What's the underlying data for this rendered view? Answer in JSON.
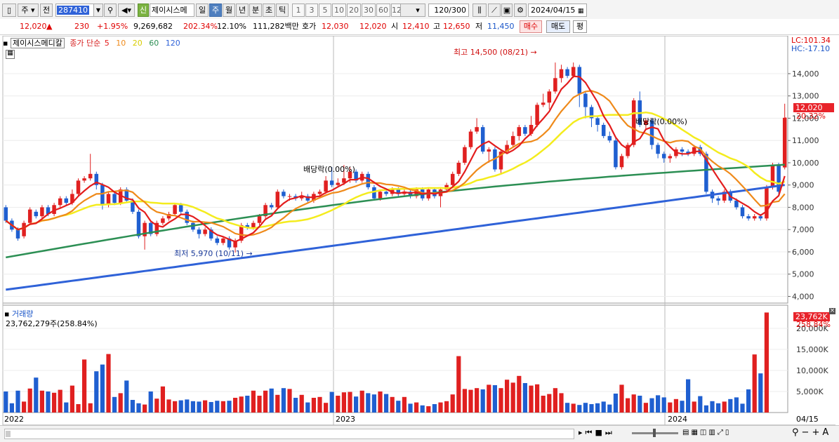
{
  "toolbar": {
    "chart_type": "주",
    "prev_label": "전",
    "code": "287410",
    "stock_tag": "신",
    "stock_name": "제이시스메",
    "periods": [
      "일",
      "주",
      "월",
      "년",
      "분",
      "초",
      "틱"
    ],
    "active_period": "주",
    "minutes": [
      "1",
      "3",
      "5",
      "10",
      "20",
      "30",
      "60",
      "120"
    ],
    "count": "120",
    "count_max": "/300",
    "date": "2024/04/15"
  },
  "quote": {
    "price": "12,020",
    "change": "230",
    "change_pct": "+1.95%",
    "volume": "9,269,682",
    "volume_ratio": "202.34%",
    "turnover": "12.10%",
    "amount": "111,282백만",
    "bid_label": "호가",
    "bid1": "12,030",
    "bid2": "12,020",
    "open_label": "시",
    "open": "12,410",
    "high_label": "고",
    "high": "12,650",
    "low_label": "저",
    "low": "11,450",
    "buy": "매수",
    "sell": "매도",
    "eval": "평"
  },
  "legend": {
    "name": "제이시스메디칼",
    "ma_title": "종가 단순",
    "ma": [
      {
        "period": "5",
        "color": "#e31d1d"
      },
      {
        "period": "10",
        "color": "#ef8a1a"
      },
      {
        "period": "20",
        "color": "#f4ec1e"
      },
      {
        "period": "60",
        "color": "#2c8f54"
      },
      {
        "period": "120",
        "color": "#2f62d8"
      }
    ]
  },
  "side": {
    "lc": "LC:101.34",
    "hc": "HC:-17.10",
    "price_badge": "12,020",
    "price_pct": "20.32%",
    "vol_badge": "23,762K",
    "vol_pct": "258.84%"
  },
  "annotations": {
    "high": "최고 14,500 (08/21)",
    "low": "최저 5,970 (10/11)",
    "dividend1": "배당락(0.00%)",
    "dividend2": "배당락(0.00%)"
  },
  "volume_pane": {
    "title": "거래량",
    "value": "23,762,279주(258.84%)"
  },
  "x_labels": [
    "2022",
    "2023",
    "2024"
  ],
  "last_date": "04/15",
  "chart_data": {
    "type": "candlestick",
    "title": "제이시스메디칼",
    "y_ticks": [
      4000,
      5000,
      6000,
      7000,
      8000,
      9000,
      10000,
      11000,
      12000,
      13000,
      14000
    ],
    "ylim": [
      3700,
      15700
    ],
    "vol_ticks": [
      "5,000K",
      "10,000K",
      "15,000K",
      "20,000K"
    ],
    "vol_tick_values": [
      5000,
      10000,
      15000,
      20000
    ],
    "vol_lim": [
      0,
      24500
    ],
    "candles": [
      [
        8000,
        7400,
        8100,
        7300
      ],
      [
        7400,
        7000,
        7500,
        6900
      ],
      [
        7000,
        6600,
        7100,
        6500
      ],
      [
        6700,
        7300,
        7400,
        6600
      ],
      [
        7300,
        7900,
        8000,
        7200
      ],
      [
        7800,
        7600,
        7900,
        7500
      ],
      [
        7600,
        8000,
        8100,
        7500
      ],
      [
        8000,
        7700,
        8100,
        7600
      ],
      [
        7700,
        8100,
        8200,
        7600
      ],
      [
        8100,
        8400,
        8500,
        8000
      ],
      [
        8400,
        8200,
        8500,
        8100
      ],
      [
        8200,
        8600,
        8800,
        8100
      ],
      [
        8600,
        9200,
        9300,
        8500
      ],
      [
        9200,
        9300,
        9400,
        9100
      ],
      [
        9300,
        9500,
        10400,
        9200
      ],
      [
        9500,
        9000,
        9600,
        8800
      ],
      [
        9000,
        8100,
        9100,
        7900
      ],
      [
        8100,
        8600,
        8700,
        8000
      ],
      [
        8600,
        8200,
        8700,
        8100
      ],
      [
        8200,
        8800,
        8900,
        8100
      ],
      [
        8800,
        8300,
        8900,
        8200
      ],
      [
        8300,
        7800,
        8400,
        7700
      ],
      [
        7800,
        6700,
        7900,
        6600
      ],
      [
        6700,
        7300,
        7400,
        6100
      ],
      [
        7300,
        6800,
        7400,
        6700
      ],
      [
        6800,
        7300,
        7400,
        6700
      ],
      [
        7300,
        7500,
        7600,
        7200
      ],
      [
        7500,
        7700,
        7800,
        7400
      ],
      [
        7700,
        8100,
        8200,
        7600
      ],
      [
        8100,
        7800,
        8200,
        7700
      ],
      [
        7800,
        7300,
        7900,
        7200
      ],
      [
        7300,
        7000,
        7400,
        6900
      ],
      [
        7000,
        6800,
        7100,
        6600
      ],
      [
        6800,
        7000,
        7100,
        6700
      ],
      [
        7000,
        6600,
        7100,
        6500
      ],
      [
        6600,
        6400,
        6700,
        6300
      ],
      [
        6400,
        6600,
        6700,
        6300
      ],
      [
        6600,
        6200,
        6700,
        6100
      ],
      [
        6200,
        6500,
        6600,
        5970
      ],
      [
        6500,
        7200,
        7300,
        6400
      ],
      [
        7200,
        7100,
        7300,
        7000
      ],
      [
        7100,
        7300,
        7400,
        7000
      ],
      [
        7300,
        7600,
        7700,
        7200
      ],
      [
        7600,
        8100,
        8200,
        7500
      ],
      [
        8100,
        8000,
        8200,
        7900
      ],
      [
        8000,
        8700,
        8800,
        7900
      ],
      [
        8700,
        8500,
        8800,
        8400
      ],
      [
        8500,
        8500,
        8600,
        8300
      ],
      [
        8500,
        8400,
        8600,
        8300
      ],
      [
        8400,
        8500,
        8700,
        8300
      ],
      [
        8500,
        8300,
        8600,
        8200
      ],
      [
        8300,
        8600,
        8700,
        8200
      ],
      [
        8600,
        8700,
        8800,
        8500
      ],
      [
        8700,
        9200,
        9400,
        8600
      ],
      [
        9200,
        9000,
        9800,
        8900
      ],
      [
        9000,
        9100,
        9300,
        8900
      ],
      [
        9100,
        9300,
        9900,
        9000
      ],
      [
        9300,
        9600,
        9800,
        9100
      ],
      [
        9600,
        9200,
        9700,
        9100
      ],
      [
        9200,
        9500,
        9600,
        9100
      ],
      [
        9500,
        8900,
        9600,
        8800
      ],
      [
        8900,
        8400,
        9000,
        8300
      ],
      [
        8400,
        8700,
        8800,
        8300
      ],
      [
        8700,
        8600,
        8800,
        8500
      ],
      [
        8600,
        8800,
        8900,
        8500
      ],
      [
        8800,
        8600,
        8900,
        8500
      ],
      [
        8600,
        8700,
        8800,
        8500
      ],
      [
        8700,
        8500,
        8800,
        8400
      ],
      [
        8500,
        8800,
        8900,
        8400
      ],
      [
        8800,
        8400,
        8900,
        8300
      ],
      [
        8400,
        8800,
        8900,
        8300
      ],
      [
        8800,
        8500,
        8900,
        8400
      ],
      [
        8500,
        8800,
        8900,
        8000
      ],
      [
        8800,
        9000,
        9100,
        8700
      ],
      [
        9000,
        9500,
        9600,
        8900
      ],
      [
        9500,
        10000,
        10100,
        9400
      ],
      [
        10000,
        10700,
        10800,
        9900
      ],
      [
        10700,
        11400,
        11500,
        10600
      ],
      [
        11400,
        11600,
        12000,
        11300
      ],
      [
        11600,
        10500,
        11700,
        10400
      ],
      [
        10500,
        10600,
        10700,
        10000
      ],
      [
        10600,
        9700,
        10700,
        9600
      ],
      [
        9700,
        10500,
        10600,
        9500
      ],
      [
        10500,
        10800,
        11000,
        10400
      ],
      [
        10800,
        11200,
        11400,
        10700
      ],
      [
        11200,
        11600,
        11700,
        11000
      ],
      [
        11600,
        11300,
        11700,
        11200
      ],
      [
        11300,
        11700,
        12100,
        11200
      ],
      [
        11700,
        12600,
        12700,
        11600
      ],
      [
        12600,
        12700,
        13100,
        12500
      ],
      [
        12700,
        13200,
        13300,
        12400
      ],
      [
        13200,
        13800,
        14500,
        13100
      ],
      [
        13800,
        14200,
        14400,
        13600
      ],
      [
        14200,
        13900,
        14300,
        13800
      ],
      [
        13900,
        14300,
        14500,
        13800
      ],
      [
        14300,
        13100,
        14400,
        12500
      ],
      [
        13100,
        12500,
        13200,
        12000
      ],
      [
        12500,
        12000,
        12600,
        11600
      ],
      [
        12000,
        11700,
        12100,
        11400
      ],
      [
        11700,
        11200,
        11800,
        11100
      ],
      [
        11200,
        11000,
        11400,
        10900
      ],
      [
        11000,
        9800,
        11100,
        9700
      ],
      [
        9800,
        10300,
        10400,
        9700
      ],
      [
        10300,
        10800,
        10900,
        10200
      ],
      [
        10800,
        12800,
        12900,
        10700
      ],
      [
        12800,
        11700,
        13200,
        11600
      ],
      [
        11700,
        11900,
        12000,
        11500
      ],
      [
        11900,
        10800,
        12000,
        10600
      ],
      [
        10800,
        10400,
        10900,
        10200
      ],
      [
        10400,
        10200,
        10500,
        10000
      ],
      [
        10200,
        10300,
        10400,
        10000
      ],
      [
        10300,
        10600,
        10700,
        10200
      ],
      [
        10600,
        10500,
        10700,
        10300
      ],
      [
        10500,
        10400,
        10600,
        10300
      ],
      [
        10400,
        10700,
        10800,
        10300
      ],
      [
        10700,
        10400,
        10800,
        10300
      ],
      [
        10400,
        8700,
        10500,
        8600
      ],
      [
        8700,
        8400,
        8800,
        8200
      ],
      [
        8400,
        8300,
        8500,
        8100
      ],
      [
        8300,
        8700,
        8800,
        8200
      ],
      [
        8700,
        8300,
        8800,
        8200
      ],
      [
        8300,
        8000,
        8400,
        7900
      ],
      [
        8000,
        7600,
        8100,
        7500
      ],
      [
        7600,
        7500,
        7700,
        7400
      ],
      [
        7500,
        7600,
        7700,
        7400
      ],
      [
        7600,
        7500,
        7700,
        7400
      ],
      [
        7500,
        8900,
        9000,
        7400
      ],
      [
        8900,
        9900,
        10000,
        8800
      ],
      [
        9900,
        8700,
        10000,
        8600
      ],
      [
        9790,
        12020,
        12650,
        9700
      ]
    ],
    "volumes": [
      5000,
      2200,
      5200,
      2600,
      5700,
      8300,
      5200,
      5000,
      4700,
      5400,
      2400,
      6400,
      2000,
      12600,
      2200,
      9800,
      11400,
      13900,
      3700,
      4600,
      7600,
      3000,
      2200,
      1900,
      5000,
      3300,
      6200,
      3100,
      2700,
      2900,
      3100,
      2700,
      2600,
      2900,
      2500,
      2800,
      2700,
      2800,
      3500,
      3800,
      4000,
      5200,
      4000,
      5200,
      5700,
      4200,
      5800,
      5600,
      3500,
      4200,
      2400,
      3500,
      3700,
      2300,
      4900,
      4000,
      4800,
      4900,
      3800,
      5200,
      4600,
      4300,
      5000,
      4400,
      3700,
      2800,
      3700,
      2100,
      2400,
      1700,
      1500,
      2000,
      2400,
      2700,
      4300,
      13400,
      5600,
      5400,
      5800,
      5500,
      6600,
      6500,
      5800,
      7800,
      7100,
      8700,
      7000,
      6400,
      6700,
      4000,
      4400,
      5800,
      4600,
      2300,
      2100,
      1800,
      2300,
      2000,
      2200,
      2600,
      1900,
      4500,
      6600,
      3400,
      4300,
      4000,
      2300,
      3400,
      4100,
      3600,
      2400,
      3200,
      2800,
      7900,
      2600,
      3900,
      1700,
      2700,
      2200,
      2600,
      3200,
      3600,
      2100,
      5500,
      13800,
      9300,
      23762
    ]
  }
}
